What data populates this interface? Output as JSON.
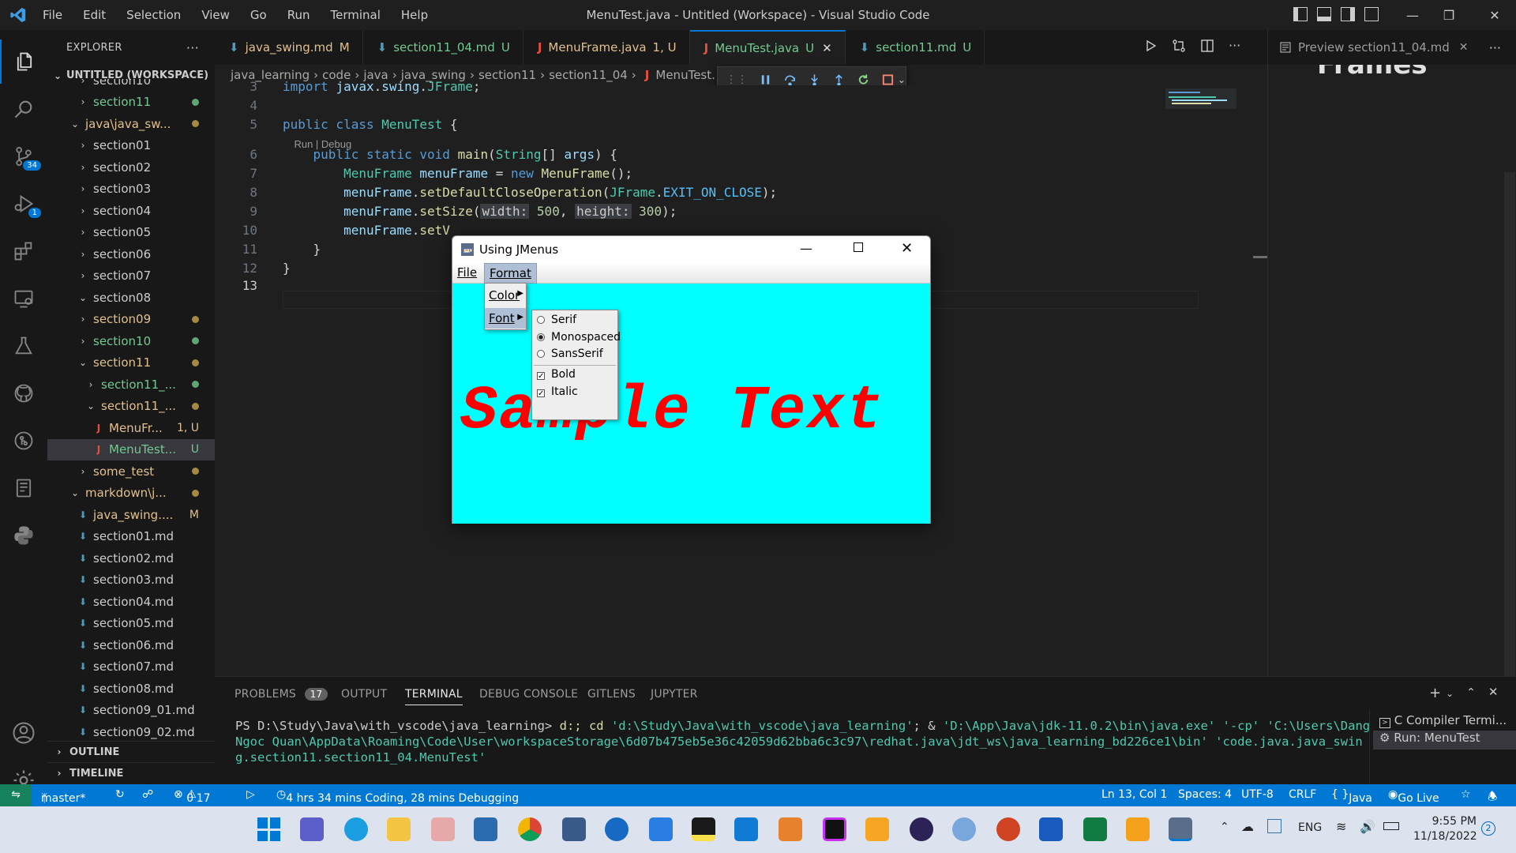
{
  "app": {
    "title": "MenuTest.java - Untitled (Workspace) - Visual Studio Code",
    "menu": [
      "File",
      "Edit",
      "Selection",
      "View",
      "Go",
      "Run",
      "Terminal",
      "Help"
    ]
  },
  "activity": {
    "source_control_badge": "34",
    "debug_badge": "1"
  },
  "sidebar": {
    "title": "EXPLORER",
    "more": "···",
    "workspace": "UNTITLED (WORKSPACE)",
    "items": [
      {
        "label": "section10",
        "indent": 1,
        "chev": "›",
        "color": "#cccccc",
        "status": ""
      },
      {
        "label": "section11",
        "indent": 1,
        "chev": "›",
        "color": "#73c991",
        "status": "dot-green"
      },
      {
        "label": "java\\java_sw...",
        "indent": 0,
        "chev": "⌄",
        "color": "#e2c08d",
        "status": "dot-yellow"
      },
      {
        "label": "section01",
        "indent": 1,
        "chev": "›",
        "color": "#cccccc",
        "status": ""
      },
      {
        "label": "section02",
        "indent": 1,
        "chev": "›",
        "color": "#cccccc",
        "status": ""
      },
      {
        "label": "section03",
        "indent": 1,
        "chev": "›",
        "color": "#cccccc",
        "status": ""
      },
      {
        "label": "section04",
        "indent": 1,
        "chev": "›",
        "color": "#cccccc",
        "status": ""
      },
      {
        "label": "section05",
        "indent": 1,
        "chev": "›",
        "color": "#cccccc",
        "status": ""
      },
      {
        "label": "section06",
        "indent": 1,
        "chev": "›",
        "color": "#cccccc",
        "status": ""
      },
      {
        "label": "section07",
        "indent": 1,
        "chev": "›",
        "color": "#cccccc",
        "status": ""
      },
      {
        "label": "section08",
        "indent": 1,
        "chev": "⌄",
        "color": "#cccccc",
        "status": ""
      },
      {
        "label": "section09",
        "indent": 1,
        "chev": "›",
        "color": "#e2c08d",
        "status": "dot-yellow"
      },
      {
        "label": "section10",
        "indent": 1,
        "chev": "›",
        "color": "#73c991",
        "status": "dot-green"
      },
      {
        "label": "section11",
        "indent": 1,
        "chev": "⌄",
        "color": "#e2c08d",
        "status": "dot-yellow"
      },
      {
        "label": "section11_...",
        "indent": 2,
        "chev": "›",
        "color": "#73c991",
        "status": "dot-green"
      },
      {
        "label": "section11_...",
        "indent": 2,
        "chev": "⌄",
        "color": "#e2c08d",
        "status": "dot-yellow"
      },
      {
        "label": "MenuFr...",
        "indent": 3,
        "chev": "J",
        "color": "#e2c08d",
        "status": "1, U"
      },
      {
        "label": "MenuTest...",
        "indent": 3,
        "chev": "J",
        "color": "#73c991",
        "status": "U"
      },
      {
        "label": "some_test",
        "indent": 1,
        "chev": "›",
        "color": "#e2c08d",
        "status": "dot-yellow"
      },
      {
        "label": "markdown\\j...",
        "indent": 0,
        "chev": "⌄",
        "color": "#e2c08d",
        "status": "dot-yellow"
      },
      {
        "label": "java_swing....",
        "indent": 1,
        "chev": "⬇",
        "color": "#e2c08d",
        "status": "M"
      },
      {
        "label": "section01.md",
        "indent": 1,
        "chev": "⬇",
        "color": "#cccccc",
        "status": ""
      },
      {
        "label": "section02.md",
        "indent": 1,
        "chev": "⬇",
        "color": "#cccccc",
        "status": ""
      },
      {
        "label": "section03.md",
        "indent": 1,
        "chev": "⬇",
        "color": "#cccccc",
        "status": ""
      },
      {
        "label": "section04.md",
        "indent": 1,
        "chev": "⬇",
        "color": "#cccccc",
        "status": ""
      },
      {
        "label": "section05.md",
        "indent": 1,
        "chev": "⬇",
        "color": "#cccccc",
        "status": ""
      },
      {
        "label": "section06.md",
        "indent": 1,
        "chev": "⬇",
        "color": "#cccccc",
        "status": ""
      },
      {
        "label": "section07.md",
        "indent": 1,
        "chev": "⬇",
        "color": "#cccccc",
        "status": ""
      },
      {
        "label": "section08.md",
        "indent": 1,
        "chev": "⬇",
        "color": "#cccccc",
        "status": ""
      },
      {
        "label": "section09_01.md",
        "indent": 1,
        "chev": "⬇",
        "color": "#cccccc",
        "status": ""
      },
      {
        "label": "section09_02.md",
        "indent": 1,
        "chev": "⬇",
        "color": "#cccccc",
        "status": ""
      }
    ],
    "outline": "OUTLINE",
    "timeline": "TIMELINE"
  },
  "tabs": [
    {
      "label": "java_swing.md",
      "status": "M",
      "icon": "markdown-icon",
      "color": "#e2c08d",
      "active": false
    },
    {
      "label": "section11_04.md",
      "status": "U",
      "icon": "markdown-icon",
      "color": "#73c991",
      "active": false
    },
    {
      "label": "MenuFrame.java",
      "status": "1, U",
      "icon": "java-icon",
      "color": "#e2c08d",
      "active": false
    },
    {
      "label": "MenuTest.java",
      "status": "U",
      "icon": "java-icon",
      "color": "#73c991",
      "active": true
    },
    {
      "label": "section11.md",
      "status": "U",
      "icon": "markdown-icon",
      "color": "#73c991",
      "active": false
    }
  ],
  "breadcrumb": [
    "java_learning",
    "code",
    "java",
    "java_swing",
    "section11",
    "section11_04",
    "MenuTest."
  ],
  "editor": {
    "lines": [
      {
        "n": "3",
        "tokens": [
          [
            "kw",
            "import "
          ],
          [
            "vr",
            "javax"
          ],
          [
            "pu",
            "."
          ],
          [
            "vr",
            "swing"
          ],
          [
            "pu",
            "."
          ],
          [
            "ty",
            "JFrame"
          ],
          [
            "pu",
            ";"
          ]
        ]
      },
      {
        "n": "4",
        "tokens": []
      },
      {
        "n": "5",
        "tokens": [
          [
            "kw",
            "public class "
          ],
          [
            "ty",
            "MenuTest"
          ],
          [
            "pu",
            " {"
          ]
        ]
      },
      {
        "n": "",
        "tokens": [
          [
            "codelens",
            "    Run | Debug"
          ]
        ]
      },
      {
        "n": "6",
        "tokens": [
          [
            "pu",
            "    "
          ],
          [
            "kw",
            "public static void "
          ],
          [
            "fn",
            "main"
          ],
          [
            "pu",
            "("
          ],
          [
            "ty",
            "String"
          ],
          [
            "pu",
            "[] "
          ],
          [
            "vr",
            "args"
          ],
          [
            "pu",
            ") {"
          ]
        ]
      },
      {
        "n": "7",
        "tokens": [
          [
            "pu",
            "        "
          ],
          [
            "ty",
            "MenuFrame "
          ],
          [
            "vr",
            "menuFrame"
          ],
          [
            "pu",
            " = "
          ],
          [
            "kw",
            "new "
          ],
          [
            "fn",
            "MenuFrame"
          ],
          [
            "pu",
            "();"
          ]
        ]
      },
      {
        "n": "8",
        "tokens": [
          [
            "pu",
            "        "
          ],
          [
            "vr",
            "menuFrame"
          ],
          [
            "pu",
            "."
          ],
          [
            "fn",
            "setDefaultCloseOperation"
          ],
          [
            "pu",
            "("
          ],
          [
            "ty",
            "JFrame"
          ],
          [
            "pu",
            "."
          ],
          [
            "cn",
            "EXIT_ON_CLOSE"
          ],
          [
            "pu",
            ");"
          ]
        ]
      },
      {
        "n": "9",
        "tokens": [
          [
            "pu",
            "        "
          ],
          [
            "vr",
            "menuFrame"
          ],
          [
            "pu",
            "."
          ],
          [
            "fn",
            "setSize"
          ],
          [
            "pu",
            "("
          ],
          [
            "hint",
            "width:"
          ],
          [
            "pu",
            " "
          ],
          [
            "nm",
            "500"
          ],
          [
            "pu",
            ", "
          ],
          [
            "hint",
            "height:"
          ],
          [
            "pu",
            " "
          ],
          [
            "nm",
            "300"
          ],
          [
            "pu",
            ");"
          ]
        ]
      },
      {
        "n": "10",
        "tokens": [
          [
            "pu",
            "        "
          ],
          [
            "vr",
            "menuFrame"
          ],
          [
            "pu",
            "."
          ],
          [
            "fn",
            "setV"
          ]
        ]
      },
      {
        "n": "11",
        "tokens": [
          [
            "pu",
            "    }"
          ]
        ]
      },
      {
        "n": "12",
        "tokens": [
          [
            "pu",
            "}"
          ]
        ]
      },
      {
        "n": "13",
        "tokens": []
      }
    ]
  },
  "debug_toolbar": [
    "pause-icon",
    "step-over-icon",
    "step-into-icon",
    "step-out-icon",
    "restart-icon",
    "stop-icon"
  ],
  "preview": {
    "tab_label": "Preview section11_04.md",
    "heading_fragment": "Frames"
  },
  "java_window": {
    "title": "Using JMenus",
    "menubar": [
      "File",
      "Format"
    ],
    "format_menu": [
      "Color",
      "Font"
    ],
    "font_menu": [
      {
        "label": "Serif",
        "kind": "radio",
        "checked": false
      },
      {
        "label": "Monospaced",
        "kind": "radio",
        "checked": true
      },
      {
        "label": "SansSerif",
        "kind": "radio",
        "checked": false
      },
      {
        "label": "Bold",
        "kind": "check",
        "checked": true
      },
      {
        "label": "Italic",
        "kind": "check",
        "checked": true
      }
    ],
    "sample_text": "Sample Text",
    "content_color": "#00ffff",
    "text_color": "#ff0000"
  },
  "panel": {
    "tabs": [
      "PROBLEMS",
      "OUTPUT",
      "TERMINAL",
      "DEBUG CONSOLE",
      "GITLENS",
      "JUPYTER"
    ],
    "problems_count": "17",
    "active_tab": "TERMINAL",
    "terminal_prompt": "PS D:\\Study\\Java\\with_vscode\\java_learning>",
    "terminal_cmd_a": " d:; cd ",
    "terminal_str1": "'d:\\Study\\Java\\with_vscode\\java_learning'",
    "terminal_cmd_b": "; & ",
    "terminal_str2": "'D:\\App\\Java\\jdk-11.0.2\\bin\\java.exe' '-cp' 'C:\\Users\\Dang Ngoc Quan\\AppData\\Roaming\\Code\\User\\workspaceStorage\\6d07b475eb5e36c42059d62bba6c3c97\\redhat.java\\jdt_ws\\java_learning_bd226ce1\\bin' 'code.java.java_swing.section11.section11_04.MenuTest'",
    "terminals": [
      "C Compiler Termi...",
      "Run: MenuTest"
    ]
  },
  "statusbar": {
    "branch": "master*",
    "errors": "0",
    "warnings": "17",
    "coding_time": "4 hrs 34 mins Coding, 28 mins Debugging",
    "position": "Ln 13, Col 1",
    "spaces": "Spaces: 4",
    "encoding": "UTF-8",
    "eol": "CRLF",
    "language": "Java",
    "golive": "Go Live"
  },
  "taskbar": {
    "lang": "ENG",
    "time": "9:55 PM",
    "date": "11/18/2022",
    "notif": "2"
  }
}
